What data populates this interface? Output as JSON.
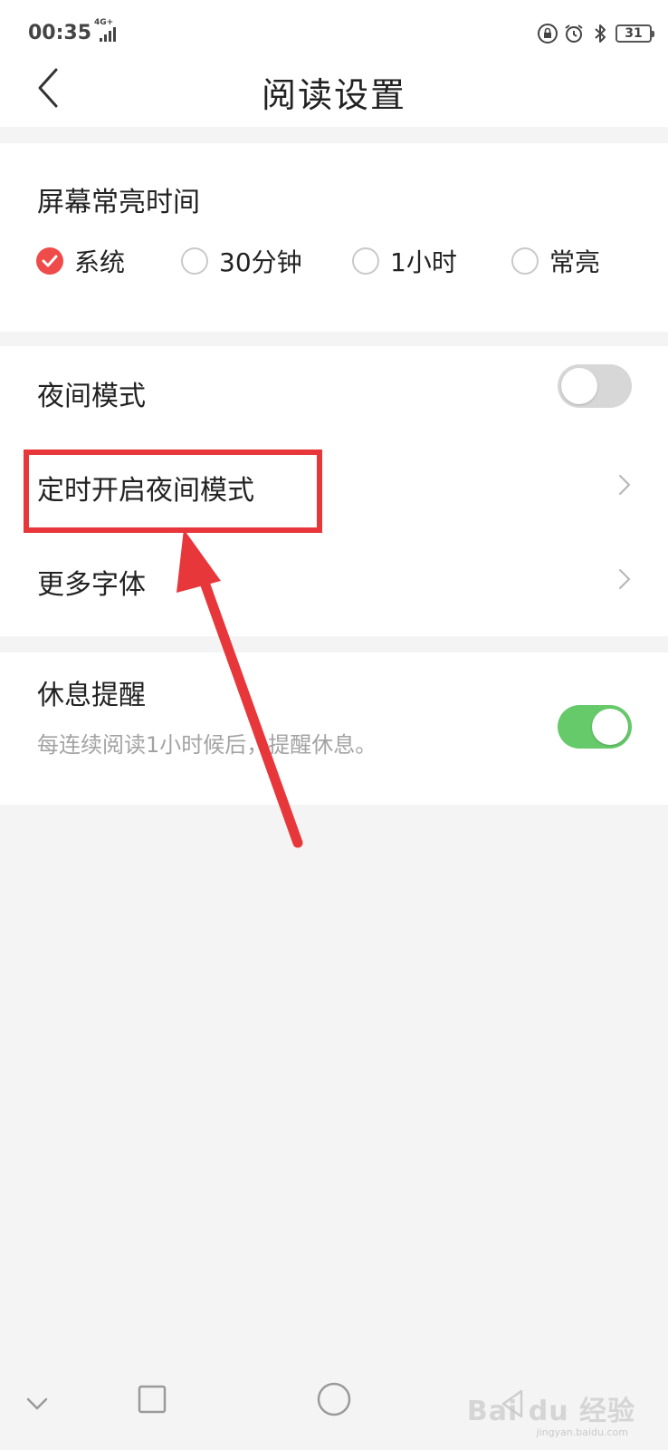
{
  "status_bar": {
    "time": "00:35",
    "network": "4G+",
    "battery": "31",
    "icons": [
      "lock-rotation-icon",
      "alarm-icon",
      "bluetooth-icon"
    ]
  },
  "header": {
    "title": "阅读设置",
    "back_icon": "chevron-left-icon"
  },
  "screen_timeout": {
    "title": "屏幕常亮时间",
    "options": [
      {
        "label": "系统",
        "checked": true
      },
      {
        "label": "30分钟",
        "checked": false
      },
      {
        "label": "1小时",
        "checked": false
      },
      {
        "label": "常亮",
        "checked": false
      }
    ],
    "accent_color": "#ef4b4b"
  },
  "display": {
    "night_mode": {
      "label": "夜间模式",
      "on": false
    },
    "scheduled_night_mode": {
      "label": "定时开启夜间模式"
    },
    "more_fonts": {
      "label": "更多字体"
    }
  },
  "rest_reminder": {
    "title": "休息提醒",
    "description": "每连续阅读1小时候后，提醒休息。",
    "on": true,
    "toggle_color": "#66c96a"
  },
  "annotation": {
    "color": "#e8373a"
  },
  "watermark": {
    "text": "Bai du 经验",
    "sub": "jingyan.baidu.com"
  }
}
